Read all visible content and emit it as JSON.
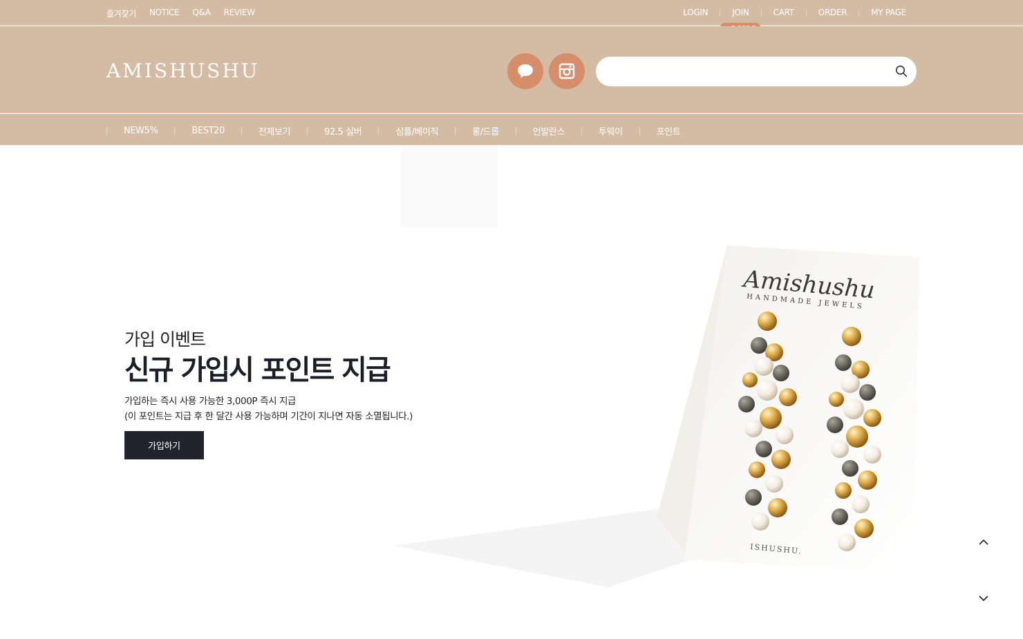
{
  "topbar": {
    "left_links": [
      "즐겨찾기",
      "NOTICE",
      "Q&A",
      "REVIEW"
    ],
    "login": "LOGIN",
    "join": "JOIN",
    "join_badge": "+3,000 P",
    "cart": "CART",
    "order": "ORDER",
    "mypage": "MY PAGE"
  },
  "header": {
    "logo": "AMISHUSHU",
    "talk_icon": "speech-bubble-icon",
    "insta_icon": "instagram-icon",
    "search": {
      "value": "",
      "placeholder": ""
    }
  },
  "categories": [
    "NEW5%",
    "BEST20",
    "전체보기",
    "92.5 실버",
    "심플/베이직",
    "롱/드롭",
    "언발란스",
    "투웨이",
    "포인트"
  ],
  "hero": {
    "eyebrow": "가입 이벤트",
    "title": "신규 가입시 포인트 지급",
    "desc_line1": "가입하는 즉시 사용 가능한 3,000P 즉시 지급",
    "desc_line2": "(이 포인트는 지급 후 한 달간 사용 가능하며 기간이 지나면 자동 소멸됩니다.)",
    "cta": "가입하기",
    "card_script": "Amishushu",
    "card_subtitle": "HANDMADE JEWELS",
    "card_bottom": "ISHUSHU."
  },
  "colors": {
    "header_bg": "#d4bba4",
    "accent": "#d68d6a",
    "cta_bg": "#23232e"
  }
}
